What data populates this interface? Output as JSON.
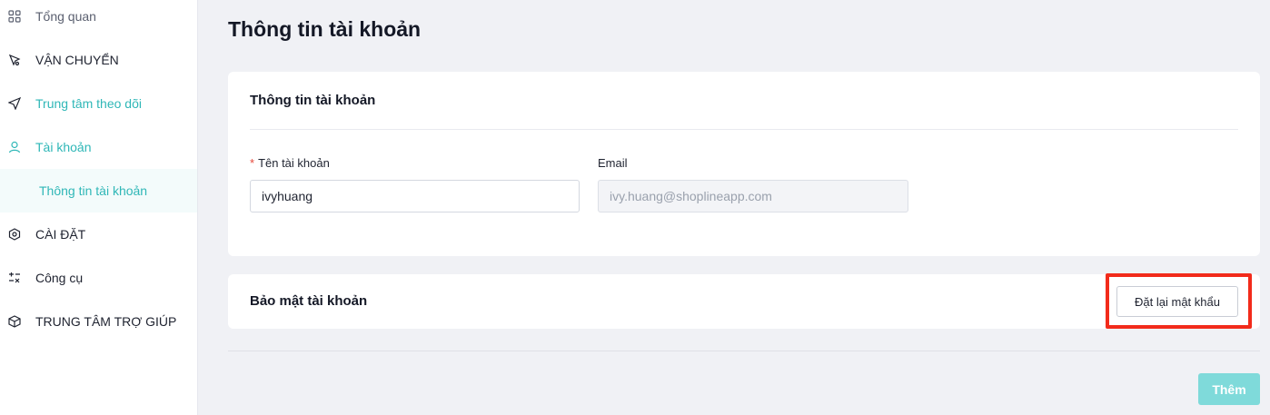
{
  "sidebar": {
    "items": [
      {
        "label": "Tổng quan",
        "icon": "dashboard-icon"
      },
      {
        "label": "VẬN CHUYỂN",
        "icon": "shipping-icon"
      },
      {
        "label": "Trung tâm theo dõi",
        "icon": "send-icon"
      },
      {
        "label": "Tài khoản",
        "icon": "user-icon"
      },
      {
        "label": "Thông tin tài khoản",
        "icon": null
      },
      {
        "label": "CÀI ĐẶT",
        "icon": "settings-hex-icon"
      },
      {
        "label": "Công cụ",
        "icon": "tools-icon"
      },
      {
        "label": "TRUNG TÂM TRỢ GIÚP",
        "icon": "help-box-icon"
      }
    ]
  },
  "page": {
    "title": "Thông tin tài khoản"
  },
  "account_card": {
    "title": "Thông tin tài khoản",
    "username_label": "Tên tài khoản",
    "required_mark": "*",
    "username_value": "ivyhuang",
    "email_label": "Email",
    "email_value": "ivy.huang@shoplineapp.com"
  },
  "security_card": {
    "title": "Bảo mật tài khoản",
    "reset_button": "Đặt lại mật khẩu"
  },
  "footer": {
    "add_button": "Thêm"
  },
  "colors": {
    "accent": "#2fb7b7",
    "add_button_bg": "#7fdada",
    "highlight": "#f22b1b",
    "background": "#f0f1f5"
  }
}
